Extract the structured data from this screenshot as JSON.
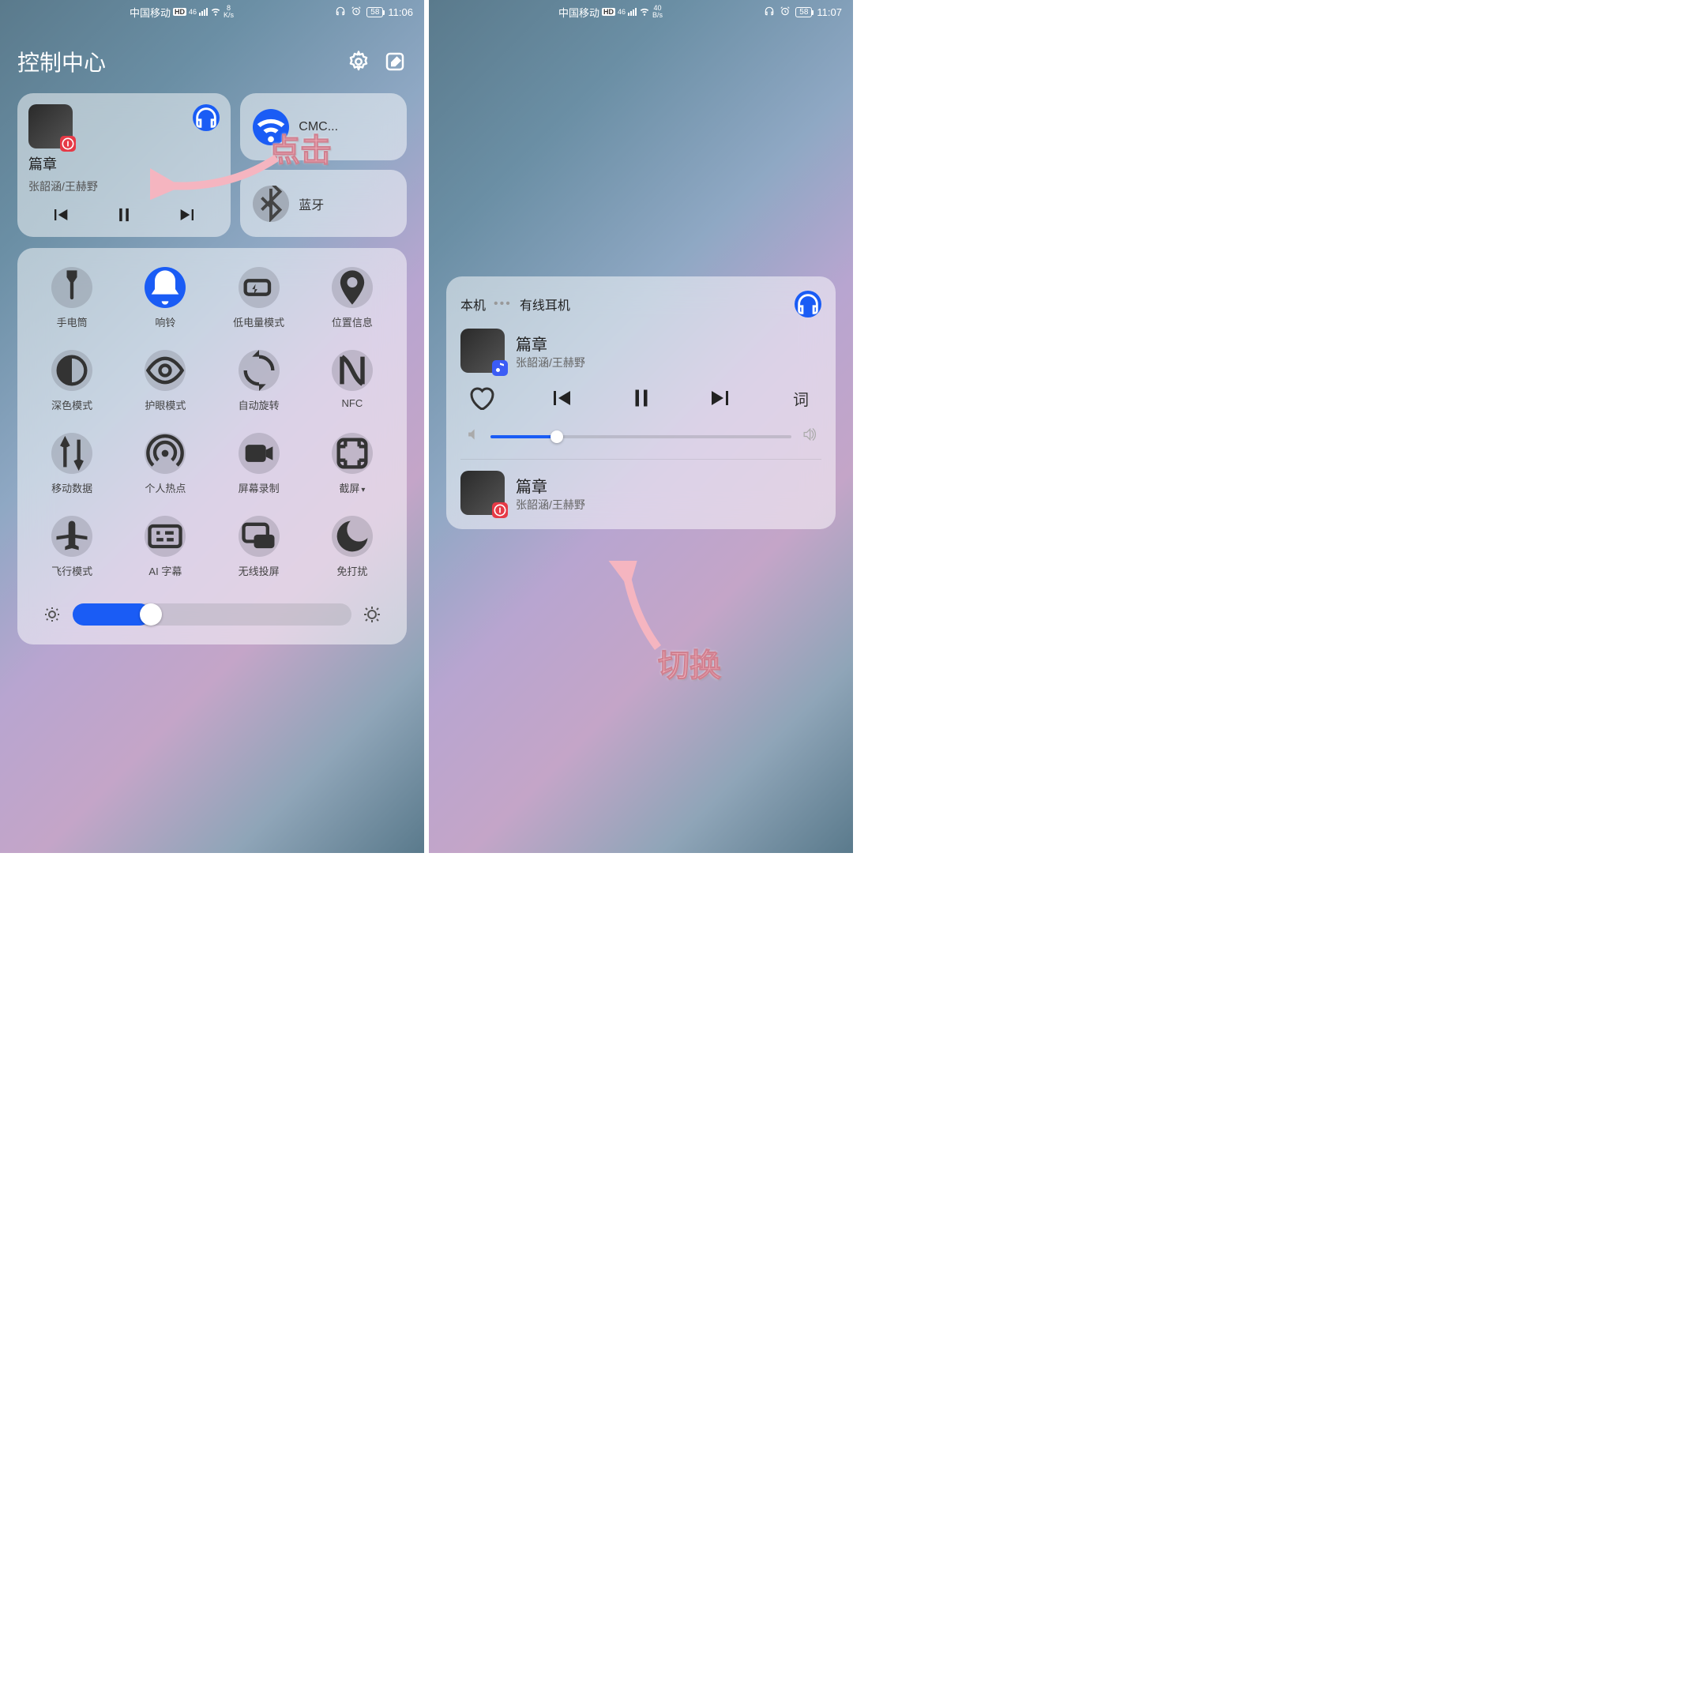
{
  "left": {
    "status": {
      "carrier": "中国移动",
      "hd": "HD",
      "net": "46",
      "speed_num": "8",
      "speed_unit": "K/s",
      "battery": "58",
      "time": "11:06"
    },
    "header": {
      "title": "控制中心"
    },
    "music": {
      "title": "篇章",
      "artist": "张韶涵/王赫野"
    },
    "wifi": {
      "label": "CMC..."
    },
    "bt": {
      "label": "蓝牙"
    },
    "toggles": [
      {
        "label": "手电筒",
        "icon": "flashlight",
        "on": false
      },
      {
        "label": "响铃",
        "icon": "bell",
        "on": true
      },
      {
        "label": "低电量模式",
        "icon": "battery-saver",
        "on": false
      },
      {
        "label": "位置信息",
        "icon": "location",
        "on": false
      },
      {
        "label": "深色模式",
        "icon": "dark",
        "on": false
      },
      {
        "label": "护眼模式",
        "icon": "eye",
        "on": false
      },
      {
        "label": "自动旋转",
        "icon": "rotate",
        "on": false
      },
      {
        "label": "NFC",
        "icon": "nfc",
        "on": false
      },
      {
        "label": "移动数据",
        "icon": "data",
        "on": false
      },
      {
        "label": "个人热点",
        "icon": "hotspot",
        "on": false
      },
      {
        "label": "屏幕录制",
        "icon": "record",
        "on": false
      },
      {
        "label": "截屏",
        "icon": "screenshot",
        "on": false,
        "chev": true
      },
      {
        "label": "飞行模式",
        "icon": "airplane",
        "on": false
      },
      {
        "label": "AI 字幕",
        "icon": "subtitle",
        "on": false
      },
      {
        "label": "无线投屏",
        "icon": "cast",
        "on": false
      },
      {
        "label": "免打扰",
        "icon": "dnd",
        "on": false
      }
    ],
    "annotation": "点击"
  },
  "right": {
    "status": {
      "carrier": "中国移动",
      "hd": "HD",
      "net": "46",
      "speed_num": "40",
      "speed_unit": "B/s",
      "battery": "58",
      "time": "11:07"
    },
    "exp": {
      "tab1": "本机",
      "tab2": "有线耳机",
      "song1": {
        "title": "篇章",
        "artist": "张韶涵/王赫野"
      },
      "lyric": "词",
      "song2": {
        "title": "篇章",
        "artist": "张韶涵/王赫野"
      }
    },
    "annotation": "切换"
  }
}
